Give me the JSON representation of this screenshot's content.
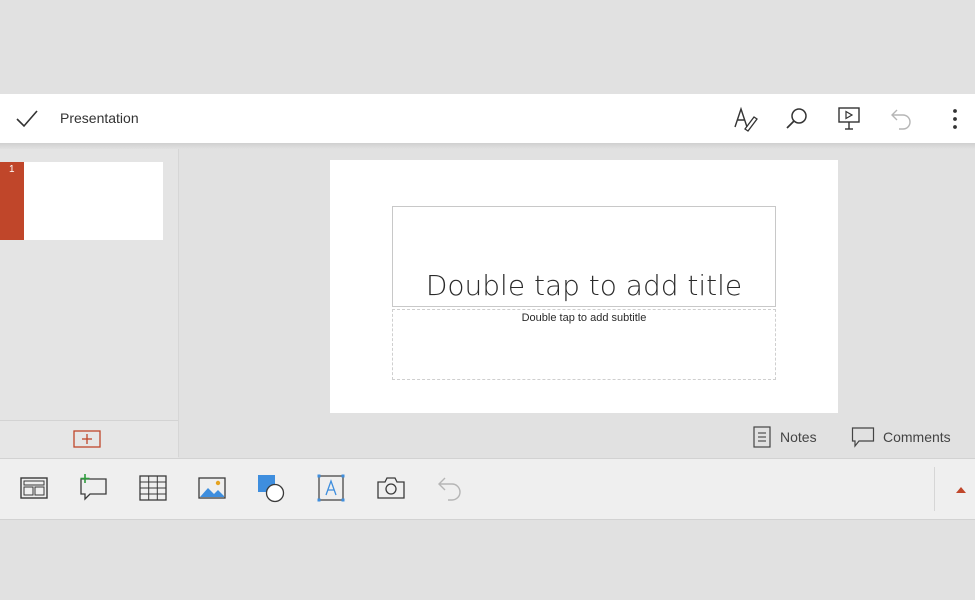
{
  "header": {
    "title": "Presentation",
    "icons": [
      "checkmark-icon",
      "draw-pen-icon",
      "search-icon",
      "present-icon",
      "undo-icon",
      "more-vertical-icon"
    ]
  },
  "slides_panel": {
    "slides": [
      {
        "number": "1"
      }
    ],
    "add_slide_icon": "add-slide-icon"
  },
  "slide": {
    "title_placeholder": "Double tap to add title",
    "subtitle_placeholder": "Double tap to add subtitle"
  },
  "bottom_links": {
    "notes": "Notes",
    "comments": "Comments"
  },
  "insert_toolbar": {
    "icons": [
      "layout-icon",
      "new-comment-icon",
      "table-icon",
      "picture-icon",
      "shapes-icon",
      "textbox-icon",
      "camera-icon",
      "undo-icon"
    ]
  },
  "colors": {
    "accent": "#c0462a",
    "background": "#e1e1e1",
    "icon": "#3a3a3a"
  }
}
